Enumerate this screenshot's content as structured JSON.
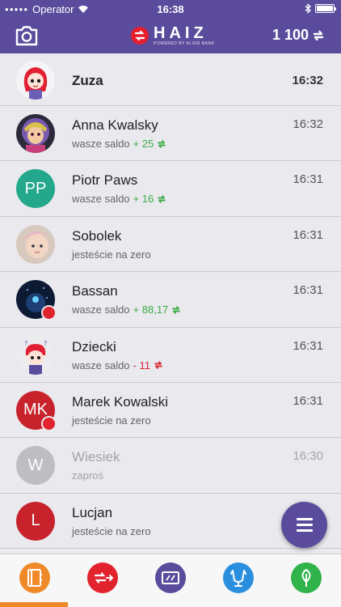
{
  "status_bar": {
    "carrier": "Operator",
    "time": "16:38",
    "battery_level": 1.0
  },
  "header": {
    "logo": {
      "name": "HAIZ",
      "tagline": "POWERED BY ALIOR BANK"
    },
    "balance": "1 100"
  },
  "colors": {
    "brand": "#5b4b9c",
    "positive": "#3fab48",
    "negative": "#d9262f",
    "accent": "#f08a29"
  },
  "contacts": [
    {
      "name": "Zuza",
      "time": "16:32",
      "status": ""
    },
    {
      "name": "Anna Kwalsky",
      "time": "16:32",
      "status": "wasze saldo",
      "amount": "+ 25"
    },
    {
      "name": "Piotr Paws",
      "initials": "PP",
      "time": "16:31",
      "status": "wasze saldo",
      "amount": "+ 16"
    },
    {
      "name": "Sobolek",
      "time": "16:31",
      "status": "jesteście na zero"
    },
    {
      "name": "Bassan",
      "time": "16:31",
      "status": "wasze saldo",
      "amount": "+ 88,17"
    },
    {
      "name": "Dziecki",
      "time": "16:31",
      "status": "wasze saldo",
      "amount": "- 11"
    },
    {
      "name": "Marek Kowalski",
      "initials": "MK",
      "time": "16:31",
      "status": "jesteście na zero"
    },
    {
      "name": "Wiesiek",
      "initials": "W",
      "time": "16:30",
      "status": "zaproś"
    },
    {
      "name": "Lucjan",
      "initials": "L",
      "time": "",
      "status": "jesteście na zero"
    }
  ],
  "tabbar": {
    "tabs": [
      "contacts-icon",
      "transfer-icon",
      "ticket-icon",
      "trophy-icon",
      "tree-icon"
    ],
    "active": 0
  }
}
